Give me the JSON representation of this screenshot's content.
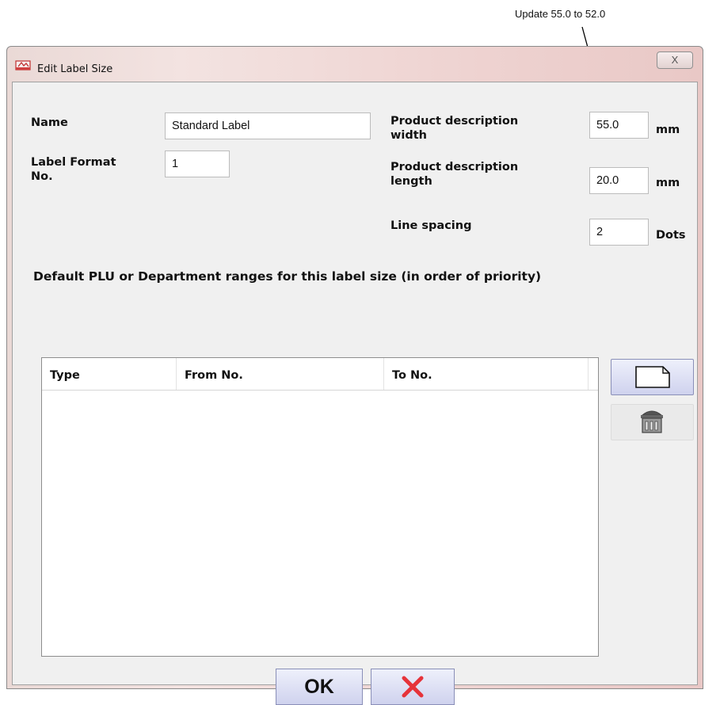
{
  "annotation": {
    "text": "Update 55.0 to 52.0"
  },
  "window": {
    "title": "Edit Label Size",
    "close_glyph": "X"
  },
  "form": {
    "name_label": "Name",
    "name_value": "Standard Label",
    "format_label_line1": "Label Format",
    "format_label_line2": "No.",
    "format_value": "1",
    "width_label_line1": "Product description",
    "width_label_line2": "width",
    "width_value": "55.0",
    "width_unit": "mm",
    "length_label_line1": "Product description",
    "length_label_line2": "length",
    "length_value": "20.0",
    "length_unit": "mm",
    "spacing_label": "Line spacing",
    "spacing_value": "2",
    "spacing_unit": "Dots"
  },
  "ranges": {
    "heading": "Default PLU or Department ranges for this label size (in order of priority)",
    "columns": [
      "Type",
      "From No.",
      "To No."
    ],
    "rows": []
  },
  "buttons": {
    "ok_label": "OK",
    "new_icon": "new-document-icon",
    "delete_icon": "trash-bin-icon",
    "cancel_icon": "red-x-icon"
  }
}
